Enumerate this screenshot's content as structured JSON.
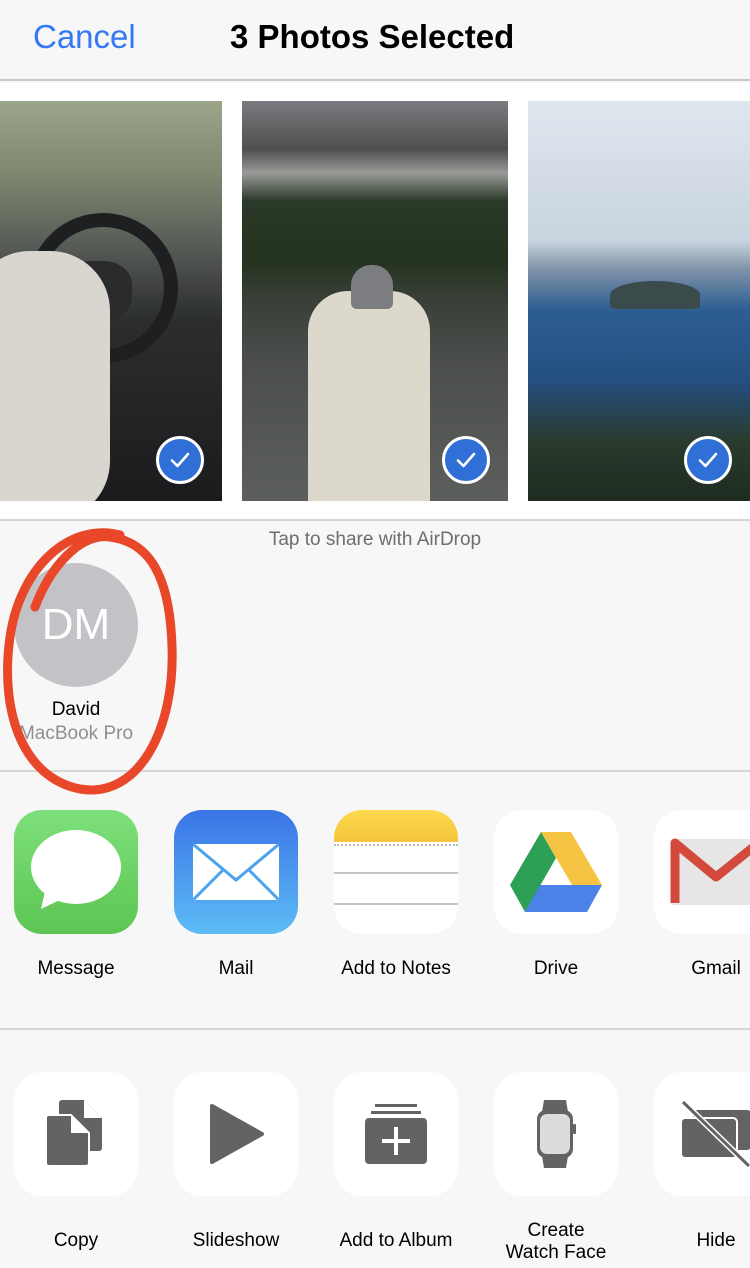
{
  "header": {
    "cancel_label": "Cancel",
    "title": "3 Photos Selected"
  },
  "photos": [
    {
      "subject": "Hand on car steering wheel",
      "selected": true
    },
    {
      "subject": "Woman in beanie standing by lake",
      "selected": true
    },
    {
      "subject": "Crater lake with island",
      "selected": true
    }
  ],
  "airdrop": {
    "hint": "Tap to share with AirDrop",
    "contacts": [
      {
        "initials": "DM",
        "name": "David",
        "device": "MacBook Pro"
      }
    ]
  },
  "share_apps": [
    {
      "label": "Message",
      "icon": "message-icon"
    },
    {
      "label": "Mail",
      "icon": "mail-icon"
    },
    {
      "label": "Add to Notes",
      "icon": "notes-icon"
    },
    {
      "label": "Drive",
      "icon": "google-drive-icon"
    },
    {
      "label": "Gmail",
      "icon": "gmail-icon"
    }
  ],
  "actions": [
    {
      "label": "Copy",
      "icon": "copy-icon"
    },
    {
      "label": "Slideshow",
      "icon": "play-icon"
    },
    {
      "label": "Add to Album",
      "icon": "add-to-album-icon"
    },
    {
      "label": "Create\nWatch Face",
      "line1": "Create",
      "line2": "Watch Face",
      "icon": "watch-icon"
    },
    {
      "label": "Hide",
      "icon": "hide-icon"
    }
  ],
  "colors": {
    "accent": "#3478f6",
    "check_badge": "#2f6fd6",
    "annotation": "#e8472a",
    "action_glyph": "#636366"
  }
}
